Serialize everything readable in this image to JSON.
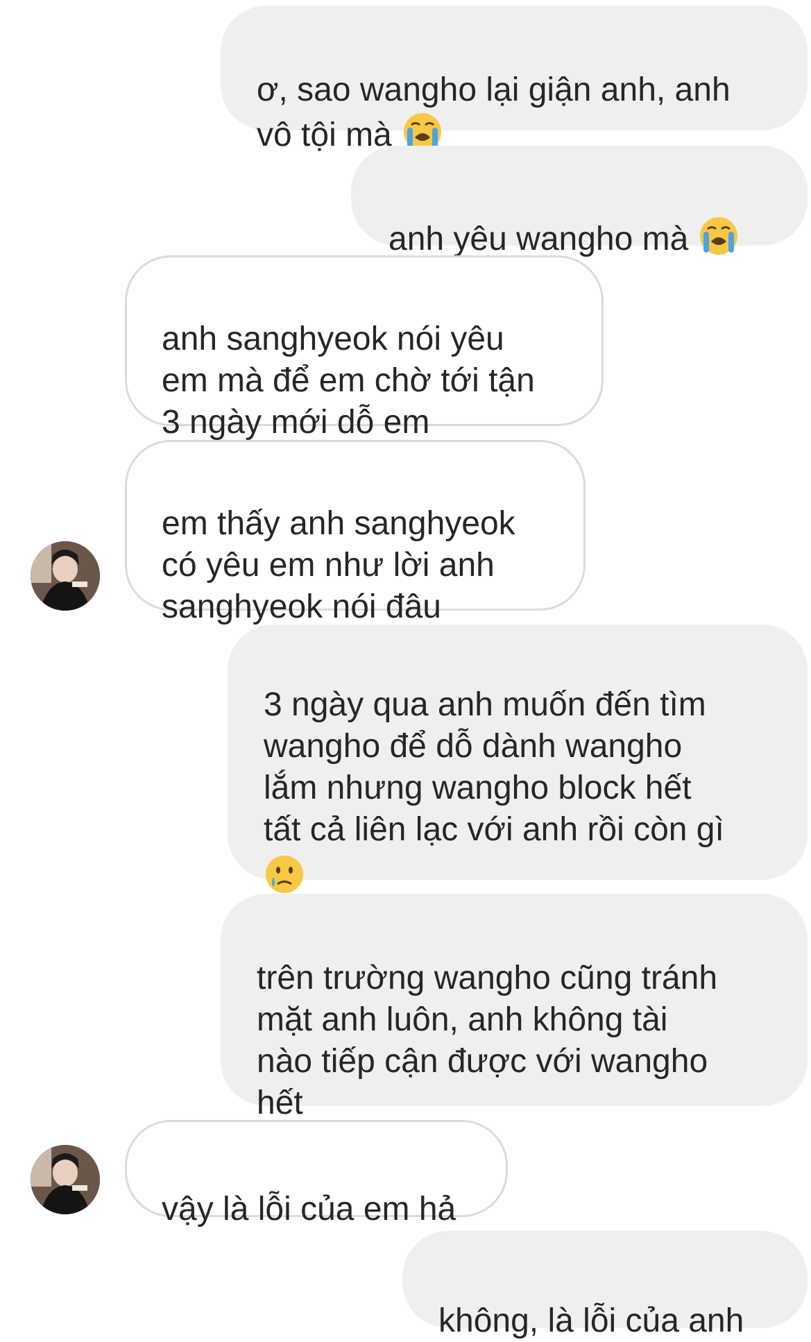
{
  "messages": [
    {
      "side": "sent",
      "text": "ơ, sao wangho lại giận anh, anh\nvô tội mà",
      "emoji": "loudly-crying-face"
    },
    {
      "side": "sent",
      "text": "anh yêu wangho mà",
      "emoji": "loudly-crying-face"
    },
    {
      "side": "received",
      "text": "anh sanghyeok nói yêu\nem mà để em chờ tới tận\n3 ngày mới dỗ em"
    },
    {
      "side": "received",
      "text": "em thấy anh sanghyeok\ncó yêu em như lời anh\nsanghyeok nói đâu",
      "avatar": "contact-avatar"
    },
    {
      "side": "sent",
      "text": "3 ngày qua anh muốn đến tìm\nwangho để dỗ dành wangho\nlắm nhưng wangho block hết\ntất cả liên lạc với anh rồi còn gì",
      "emoji": "crying-face"
    },
    {
      "side": "sent",
      "text": "trên trường wangho cũng tránh\nmặt anh luôn, anh không tài\nnào tiếp cận được với wangho\nhết"
    },
    {
      "side": "received",
      "text": "vậy là lỗi của em hả",
      "avatar": "contact-avatar"
    },
    {
      "side": "sent",
      "text": "không, là lỗi của anh"
    }
  ],
  "colors": {
    "sent_bubble": "#efefef",
    "received_bubble": "#ffffff",
    "received_border": "#dbdbdb",
    "text": "#262626",
    "emoji_face": "#f7c843",
    "emoji_tears": "#4aa3e8"
  }
}
